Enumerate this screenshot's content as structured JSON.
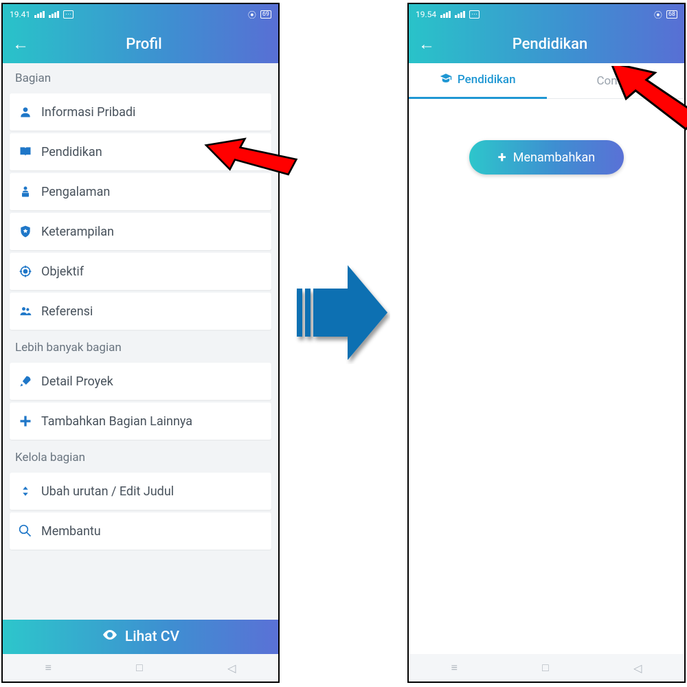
{
  "left": {
    "status": {
      "time": "19.41",
      "battery": "69"
    },
    "header": {
      "title": "Profil"
    },
    "sections": {
      "bagian_label": "Bagian",
      "items": [
        {
          "label": "Informasi Pribadi",
          "icon": "person-icon"
        },
        {
          "label": "Pendidikan",
          "icon": "book-icon"
        },
        {
          "label": "Pengalaman",
          "icon": "briefcase-person-icon"
        },
        {
          "label": "Keterampilan",
          "icon": "shield-star-icon"
        },
        {
          "label": "Objektif",
          "icon": "target-icon"
        },
        {
          "label": "Referensi",
          "icon": "people-icon"
        }
      ],
      "lebih_label": "Lebih banyak bagian",
      "lebih_items": [
        {
          "label": "Detail Proyek",
          "icon": "rocket-icon"
        },
        {
          "label": "Tambahkan Bagian Lainnya",
          "icon": "plus-icon"
        }
      ],
      "kelola_label": "Kelola bagian",
      "kelola_items": [
        {
          "label": "Ubah urutan / Edit Judul",
          "icon": "sort-icon"
        },
        {
          "label": "Membantu",
          "icon": "help-icon"
        }
      ]
    },
    "footer": {
      "view_cv_label": "Lihat  CV"
    }
  },
  "right": {
    "status": {
      "time": "19.54",
      "battery": "68"
    },
    "header": {
      "title": "Pendidikan"
    },
    "tabs": {
      "active_label": "Pendidikan",
      "inactive_label": "Contoh"
    },
    "add_button_label": "Menambahkan"
  }
}
